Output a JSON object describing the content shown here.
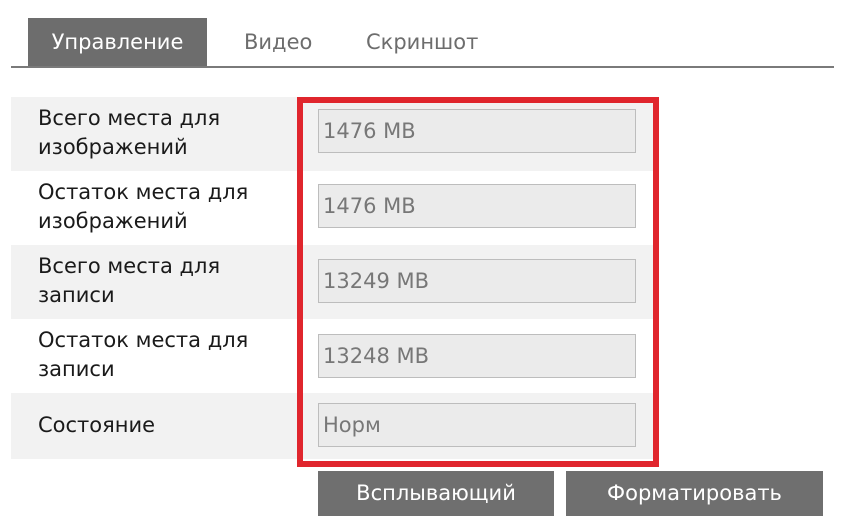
{
  "tabs": [
    {
      "label": "Управление",
      "active": true
    },
    {
      "label": "Видео",
      "active": false
    },
    {
      "label": "Скриншот",
      "active": false
    }
  ],
  "rows": [
    {
      "label": "Всего места для изображений",
      "value": "1476 MB"
    },
    {
      "label": "Остаток места для изображений",
      "value": "1476 MB"
    },
    {
      "label": "Всего места для записи",
      "value": "13249 MB"
    },
    {
      "label": "Остаток места для записи",
      "value": "13248 MB"
    },
    {
      "label": "Состояние",
      "value": "Норм"
    }
  ],
  "buttons": {
    "popup_label": "Всплывающий",
    "format_label": "Форматировать"
  },
  "colors": {
    "highlight": "#e0262d",
    "tab_active_bg": "#6d6d6d",
    "button_bg": "#6f6f6f",
    "field_bg": "#ebebeb"
  }
}
